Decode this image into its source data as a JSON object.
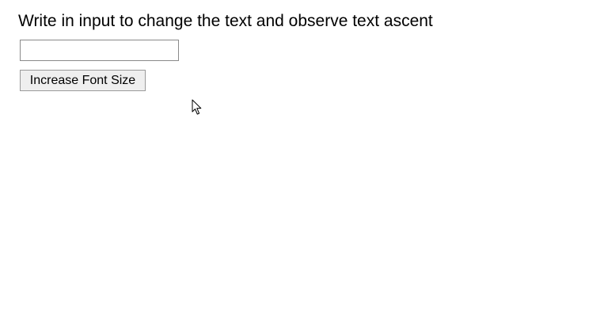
{
  "heading": "Write in input to change the text and observe text ascent",
  "input": {
    "value": "",
    "placeholder": ""
  },
  "button": {
    "label": "Increase Font Size"
  },
  "pointer": {
    "icon": "mouse-pointer-icon"
  }
}
